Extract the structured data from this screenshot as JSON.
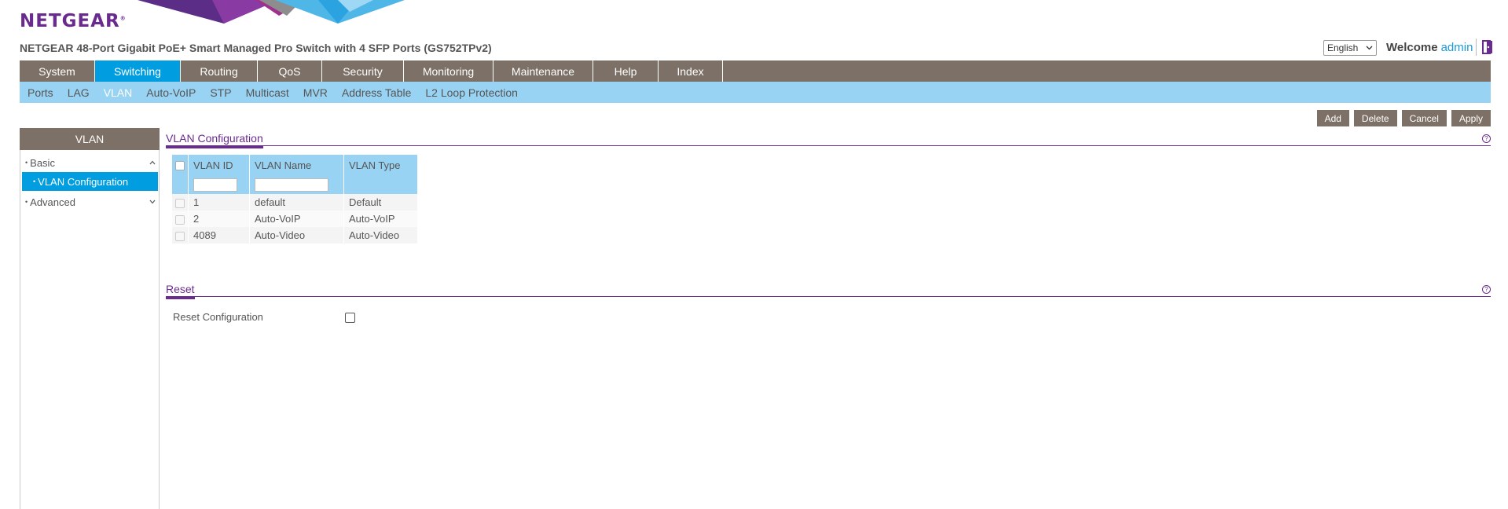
{
  "header": {
    "logo_text": "NETGEAR",
    "logo_mark": "®",
    "product_title": "NETGEAR 48-Port Gigabit PoE+ Smart Managed Pro Switch with 4 SFP Ports (GS752TPv2)",
    "language": "English",
    "welcome_label": "Welcome",
    "username": "admin",
    "logout_icon": "logout-icon"
  },
  "main_menu": [
    "System",
    "Switching",
    "Routing",
    "QoS",
    "Security",
    "Monitoring",
    "Maintenance",
    "Help",
    "Index"
  ],
  "main_menu_active": "Switching",
  "sub_menu": [
    "Ports",
    "LAG",
    "VLAN",
    "Auto-VoIP",
    "STP",
    "Multicast",
    "MVR",
    "Address Table",
    "L2 Loop Protection"
  ],
  "sub_menu_active": "VLAN",
  "actions": {
    "add": "Add",
    "delete": "Delete",
    "cancel": "Cancel",
    "apply": "Apply"
  },
  "left_panel": {
    "title": "VLAN",
    "basic": "Basic",
    "vlan_configuration": "VLAN Configuration",
    "advanced": "Advanced"
  },
  "vlan_section": {
    "title": "VLAN Configuration",
    "columns": {
      "id": "VLAN ID",
      "name": "VLAN Name",
      "type": "VLAN Type"
    },
    "rows": [
      {
        "id": "1",
        "name": "default",
        "type": "Default"
      },
      {
        "id": "2",
        "name": "Auto-VoIP",
        "type": "Auto-VoIP"
      },
      {
        "id": "4089",
        "name": "Auto-Video",
        "type": "Auto-Video"
      }
    ]
  },
  "reset_section": {
    "title": "Reset",
    "label": "Reset Configuration"
  },
  "help_icon": "?",
  "colors": {
    "brand_purple": "#6a2b8e",
    "menu_gray": "#7d7066",
    "active_blue": "#009ee0",
    "submenu_blue": "#99d3f3"
  }
}
